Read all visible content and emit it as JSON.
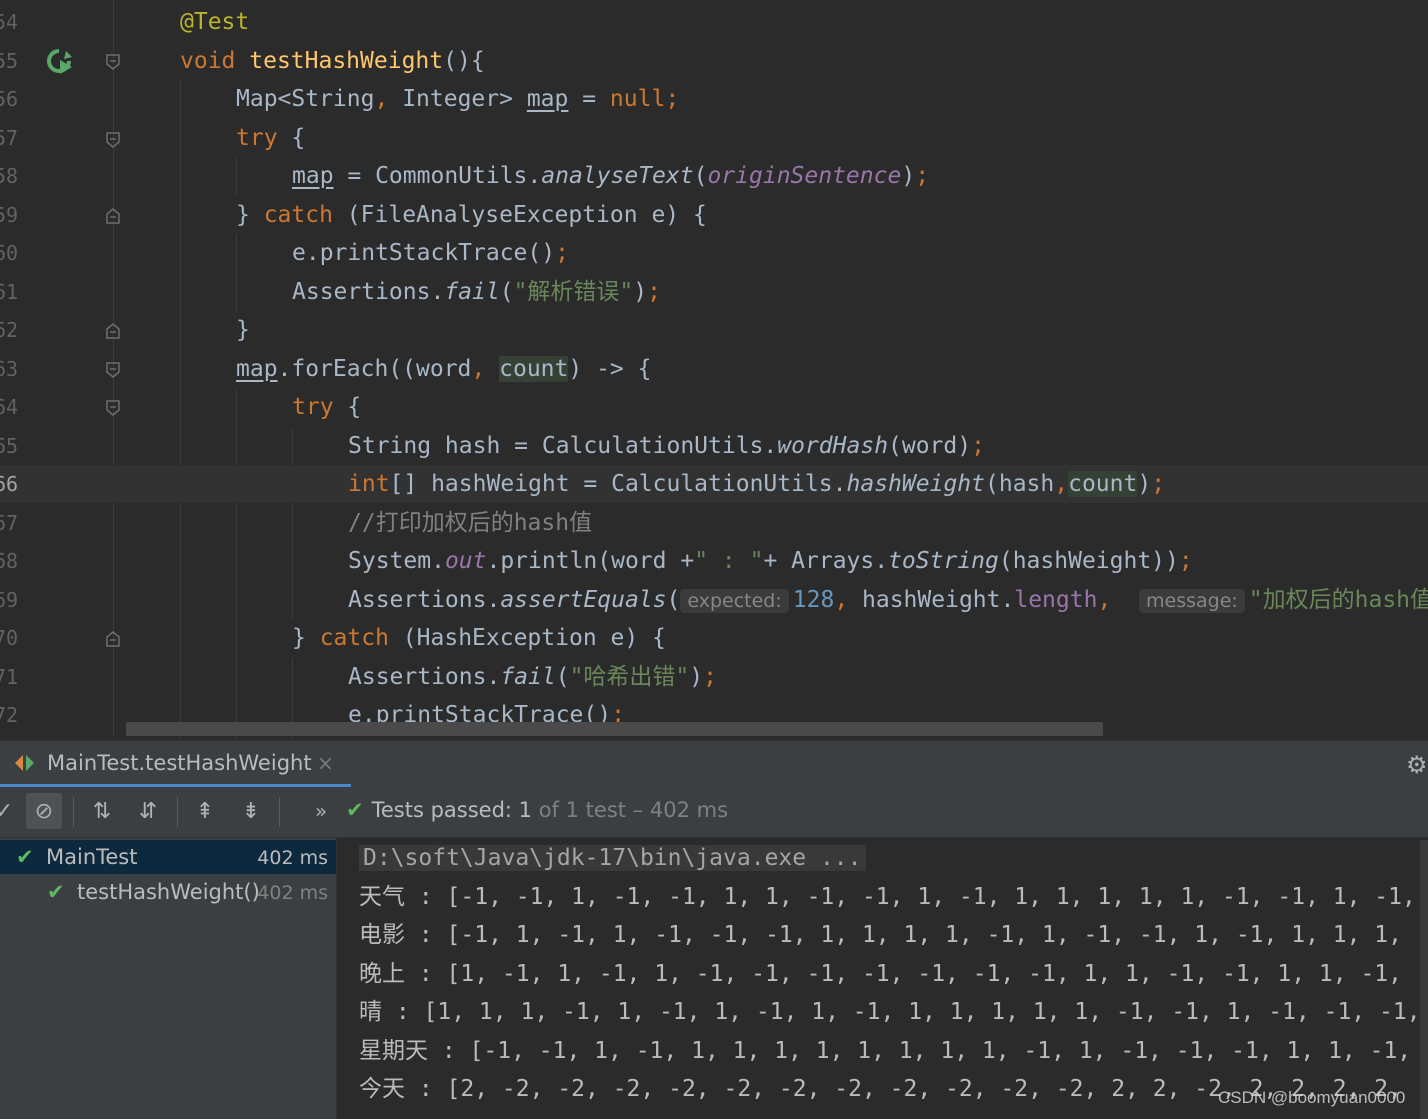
{
  "editor": {
    "lines": [
      {
        "num": "54"
      },
      {
        "num": "55"
      },
      {
        "num": "56"
      },
      {
        "num": "57"
      },
      {
        "num": "58"
      },
      {
        "num": "59"
      },
      {
        "num": "60"
      },
      {
        "num": "61"
      },
      {
        "num": "62"
      },
      {
        "num": "63"
      },
      {
        "num": "64"
      },
      {
        "num": "65"
      },
      {
        "num": "66"
      },
      {
        "num": "67"
      },
      {
        "num": "68"
      },
      {
        "num": "69"
      },
      {
        "num": "70"
      },
      {
        "num": "71"
      },
      {
        "num": "72"
      }
    ],
    "code": {
      "annotation": "@Test",
      "kw_void": "void",
      "method_name": "testHashWeight",
      "sig_rest": "(){",
      "l56_type": "Map<String",
      "l56_comma": ",",
      "l56_type2": " Integer> ",
      "l56_var": "map",
      "l56_eq": " = ",
      "l56_null": "null",
      "semi": ";",
      "kw_try": "try",
      "brace_open": " {",
      "l58_var": "map",
      "l58_eq": " = CommonUtils.",
      "l58_method": "analyseText",
      "l58_paren": "(",
      "l58_field": "originSentence",
      "l58_close": ")",
      "l59_close": "} ",
      "kw_catch": "catch",
      "l59_rest": " (FileAnalyseException e) {",
      "l60_text": "e.printStackTrace()",
      "l61_obj": "Assertions.",
      "l61_method": "fail",
      "l61_str": "\"解析错误\"",
      "paren_open": "(",
      "paren_close": ")",
      "l62_text": "}",
      "l63_var": "map",
      "l63_mid": ".forEach((word",
      "l63_comma": ",",
      "l63_count": "count",
      "l63_rest": ") -> {",
      "l65_text": "String hash = CalculationUtils.",
      "l65_method": "wordHash",
      "l65_args": "(word)",
      "l66_int": "int",
      "l66_mid": "[] hashWeight = CalculationUtils.",
      "l66_method": "hashWeight",
      "l66_args": "(hash",
      "l66_comma": ",",
      "l66_count": "count",
      "l66_close": ")",
      "l67_comment": "//打印加权后的hash值",
      "l68_obj": "System.",
      "l68_field": "out",
      "l68_mid": ".println(word +",
      "l68_str": "\" : \"",
      "l68_rest": "+ Arrays.",
      "l68_method": "toString",
      "l68_args": "(hashWeight))",
      "l69_obj": "Assertions.",
      "l69_method": "assertEquals",
      "l69_hint1": "expected:",
      "l69_num": "128",
      "l69_comma": ",",
      "l69_mid": " hashWeight.",
      "l69_field": "length",
      "l69_hint2": "message:",
      "l69_str": "\"加权后的hash值",
      "l70_close": "} ",
      "l70_rest": " (HashException e) {",
      "l71_obj": "Assertions.",
      "l71_method": "fail",
      "l71_str": "\"哈希出错\"",
      "l72_text": "e.printStackTrace()"
    }
  },
  "run_panel": {
    "tab_label": "MainTest.testHashWeight",
    "tab_close": "×",
    "status_prefix": "Tests passed: ",
    "status_count": "1",
    "status_suffix": " of 1 test – 402 ms",
    "tree": [
      {
        "label": "MainTest",
        "time": "402 ms"
      },
      {
        "label": "testHashWeight()",
        "time": "402 ms"
      }
    ],
    "console": [
      "D:\\soft\\Java\\jdk-17\\bin\\java.exe ...",
      "天气 : [-1, -1, 1, -1, -1, 1, 1, -1, -1, 1, -1, 1, 1, 1, 1, 1, -1, -1, 1, -1,",
      "电影 : [-1, 1, -1, 1, -1, -1, -1, 1, 1, 1, 1, -1, 1, -1, -1, 1, -1, 1, 1, 1,",
      "晚上 : [1, -1, 1, -1, 1, -1, -1, -1, -1, -1, -1, -1, 1, 1, -1, -1, 1, 1, -1,",
      "晴 : [1, 1, 1, -1, 1, -1, 1, -1, 1, -1, 1, 1, 1, 1, 1, -1, -1, 1, -1, -1, -1,",
      "星期天 : [-1, -1, 1, -1, 1, 1, 1, 1, 1, 1, 1, 1, -1, 1, -1, -1, -1, 1, 1, -1,",
      "今天 : [2, -2, -2, -2, -2, -2, -2, -2, -2, -2, -2, -2, 2, 2, -2, 2, 2, 2, 2,"
    ]
  },
  "watermark": "CSDN @boomyuan0000",
  "colors": {
    "keyword": "#cc7832",
    "string": "#6a8759",
    "method": "#ffc66d",
    "field": "#9876aa",
    "number": "#6897bb",
    "pass_green": "#5fb85f",
    "selection": "#0d293e"
  }
}
